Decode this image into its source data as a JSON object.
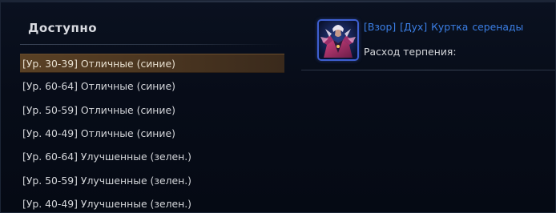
{
  "panel": {
    "title": "Доступно",
    "items": [
      {
        "label": "[Ур. 30-39] Отличные (синие)",
        "selected": true
      },
      {
        "label": "[Ур. 60-64] Отличные (синие)",
        "selected": false
      },
      {
        "label": "[Ур. 50-59] Отличные (синие)",
        "selected": false
      },
      {
        "label": "[Ур. 40-49] Отличные (синие)",
        "selected": false
      },
      {
        "label": "[Ур. 60-64] Улучшенные (зелен.)",
        "selected": false
      },
      {
        "label": "[Ур. 50-59] Улучшенные (зелен.)",
        "selected": false
      },
      {
        "label": "[Ур. 40-49] Улучшенные (зелен.)",
        "selected": false
      }
    ]
  },
  "detail": {
    "item_name": "[Взор]  [Дух]  Куртка серенады",
    "cost_label": "Расход терпения:",
    "icon": "jacket-item-icon",
    "rarity_color": "#3b7fe6"
  },
  "colors": {
    "selected_row": "#5a4125",
    "text": "#d4d6da",
    "background": "#070c18"
  }
}
